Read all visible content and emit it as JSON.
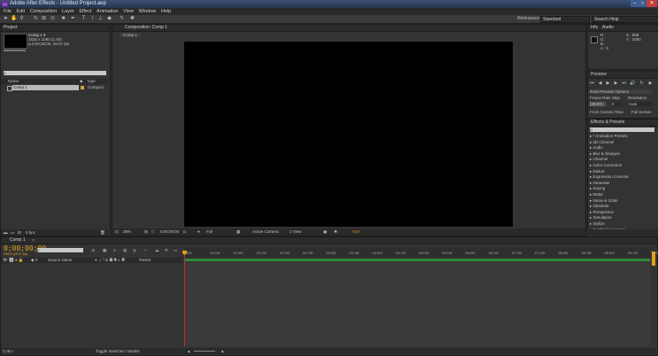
{
  "app": {
    "title": "Adobe After Effects - Untitled Project.aep"
  },
  "menu": [
    "File",
    "Edit",
    "Composition",
    "Layer",
    "Effect",
    "Animation",
    "View",
    "Window",
    "Help"
  ],
  "toolbar": {
    "workspace_label": "Workspace:",
    "workspace_value": "Standard",
    "search_help": "Search Help"
  },
  "project": {
    "tab": "Project",
    "comp_name": "Comp 1 ▾",
    "comp_info1": "1920 x 1080 (1.00)",
    "comp_info2": "Δ 0;00;30;00, 29.97 fps",
    "search_placeholder": "ρ",
    "col_name": "Name",
    "col_type": "Type",
    "item_name": "Comp 1",
    "item_type": "Composi",
    "bpc": "8 bpc"
  },
  "composition": {
    "tab": "Composition: Comp 1",
    "subtab": "Comp 1"
  },
  "viewer_bar": {
    "zoom": "38%",
    "timecode": "0;00;00;00",
    "resolution": "Full",
    "camera": "Active Camera",
    "views": "1 View",
    "exposure": "+0.0"
  },
  "info": {
    "tab1": "Info",
    "tab2": "Audio",
    "r": "R :",
    "g": "G :",
    "b": "B :",
    "a": "A : 0",
    "x": "X : 808",
    "y": "Y : 1000"
  },
  "preview": {
    "tab": "Preview",
    "ram_options": "RAM Preview Options",
    "frame_rate_label": "Frame Rate",
    "skip_label": "Skip",
    "resolution_label": "Resolution",
    "frame_rate_value": "(29.97)",
    "skip_value": "0",
    "resolution_value": "Auto",
    "from_current": "From Current Time",
    "full_screen": "Full Screen"
  },
  "effects": {
    "tab": "Effects & Presets",
    "search_placeholder": "ρ",
    "items": [
      "▸ * Animation Presets",
      "▸ 3D Channel",
      "▸ Audio",
      "▸ Blur & Sharpen",
      "▸ Channel",
      "▸ Color Correction",
      "▸ Distort",
      "▸ Expression Controls",
      "▸ Generate",
      "▸ Keying",
      "▸ Matte",
      "▸ Noise & Grain",
      "▸ Obsolete",
      "▸ Perspective",
      "▸ Simulation",
      "▸ Stylize",
      "▸ Synthetic Aperture"
    ]
  },
  "timeline": {
    "tab": "Comp 1",
    "timecode": "0;00;00;00",
    "frames": "00000 (29.97 fps)",
    "search_placeholder": "ρ",
    "source_name": "Source Name",
    "parent": "Parent",
    "ticks": [
      "00f",
      "00:15f",
      "01:00f",
      "01:15f",
      "02:00f",
      "02:15f",
      "03:00f",
      "03:15f",
      "04:00f",
      "04:15f",
      "05:00f",
      "05:15f",
      "06:00f",
      "06:15f",
      "07:00f",
      "07:15f",
      "08:00f",
      "08:15f",
      "09:00f",
      "09:15f",
      "10:00f"
    ],
    "toggle": "Toggle Switches / Modes"
  },
  "colors": {
    "accent": "#e1a21a",
    "timeline_bar": "#2e8b33",
    "playhead": "#c0302c"
  }
}
